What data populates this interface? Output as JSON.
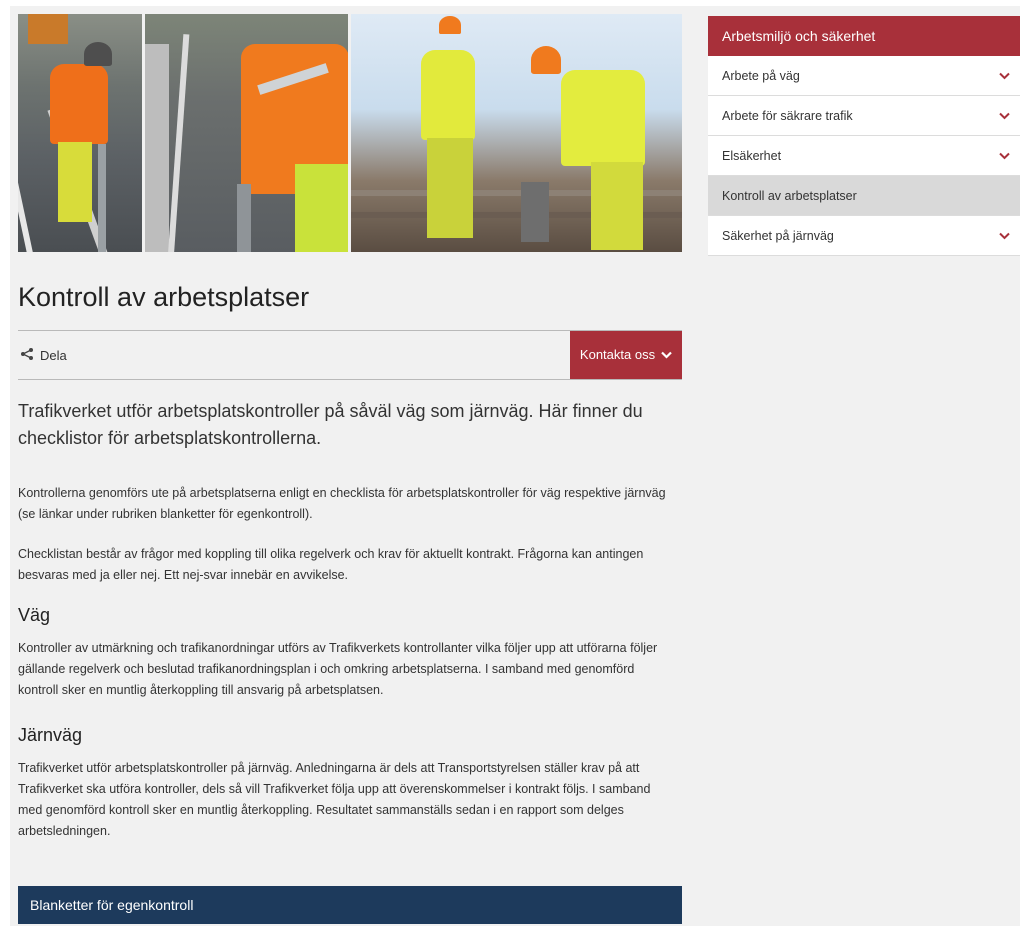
{
  "page": {
    "title": "Kontroll av arbetsplatser",
    "share_label": "Dela",
    "contact_label": "Kontakta oss",
    "lead": "Trafikverket utför arbetsplatskontroller på såväl väg som järnväg. Här finner du checklistor för arbetsplatskontrollerna.",
    "paragraphs": [
      "Kontrollerna genomförs ute på arbetsplatserna enligt en checklista för arbetsplatskontroller för väg respektive järnväg (se länkar under rubriken blanketter för egenkontroll).",
      "Checklistan består av frågor med koppling till olika regelverk och krav för aktuellt kontrakt. Frågorna kan antingen besvaras med ja eller nej. Ett nej-svar innebär en avvikelse."
    ],
    "sections": [
      {
        "heading": "Väg",
        "text": "Kontroller av utmärkning och trafikanordningar utförs av Trafikverkets kontrollanter vilka följer upp att utförarna följer gällande regelverk och beslutad trafikanordningsplan i och omkring arbetsplatserna. I samband med genomförd kontroll sker en muntlig återkoppling till ansvarig på arbetsplatsen."
      },
      {
        "heading": "Järnväg",
        "text": "Trafikverket utför arbetsplatskontroller på järnväg. Anledningarna är dels att Transportstyrelsen ställer krav på att Trafikverket ska utföra kontroller, dels så vill Trafikverket följa upp att överenskommelser i kontrakt följs. I samband med genomförd kontroll sker en muntlig återkoppling. Resultatet sammanställs sedan i en rapport som delges arbetsledningen."
      }
    ],
    "section_bar": "Blanketter för egenkontroll"
  },
  "sidebar": {
    "heading": "Arbetsmiljö och säkerhet",
    "items": [
      {
        "label": "Arbete på väg"
      },
      {
        "label": "Arbete för säkrare trafik"
      },
      {
        "label": "Elsäkerhet"
      },
      {
        "label": "Kontroll av arbetsplatser"
      },
      {
        "label": "Säkerhet på järnväg"
      }
    ]
  },
  "colors": {
    "accent_red": "#a8303a",
    "navy": "#1d3a5c",
    "background": "#f1f1f1"
  }
}
